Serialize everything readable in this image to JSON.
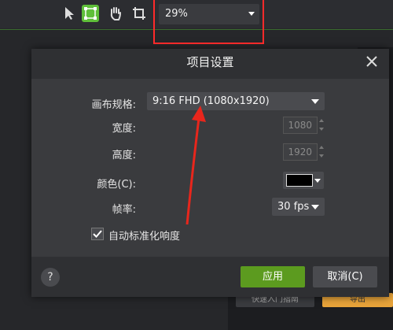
{
  "toolbar": {
    "tools": [
      {
        "name": "select-arrow-icon"
      },
      {
        "name": "crop-handles-icon",
        "active": true
      },
      {
        "name": "hand-pan-icon"
      },
      {
        "name": "crop-icon"
      }
    ],
    "zoom_value": "29%"
  },
  "dialog": {
    "title": "项目设置",
    "canvas_label": "画布规格:",
    "canvas_value": "9:16 FHD (1080x1920)",
    "width_label": "宽度:",
    "width_value": "1080",
    "height_label": "高度:",
    "height_value": "1920",
    "color_label": "颜色(C):",
    "color_value": "#000000",
    "fps_label": "帧率:",
    "fps_value": "30 fps",
    "auto_label": "自动标准化响度",
    "auto_checked": true,
    "help_label": "?",
    "apply_label": "应用",
    "cancel_label": "取消(C)"
  },
  "background": {
    "btn1_label": "快速入门指南",
    "btn2_label": "导出"
  },
  "colors": {
    "accent_green": "#5c9b1f",
    "highlight_red": "#ff2a2a",
    "arrow_red": "#e8261c"
  }
}
